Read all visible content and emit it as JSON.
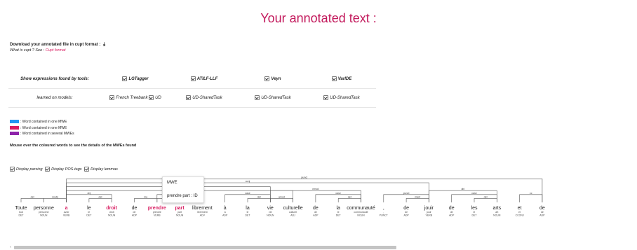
{
  "title": "Your annotated text :",
  "download": {
    "label": "Download your annotated file in cupt format :",
    "icon": "download-icon",
    "icon_glyph": "⤓"
  },
  "cupt_info": {
    "prefix": "What is cupt ? See : ",
    "link": "Cupt format"
  },
  "tools_table": {
    "row1_label": "Show expressions found by tools:",
    "row2_label": "learned on models:",
    "tools": [
      "LGTagger",
      "ATILF-LLF",
      "Veyn",
      "VarIDE"
    ],
    "models": [
      [
        "French Treebank",
        "UD"
      ],
      [
        "UD-SharedTask"
      ],
      [
        "UD-SharedTask"
      ],
      [
        "UD-SharedTask"
      ]
    ]
  },
  "legend": [
    {
      "color": "#2196f3",
      "text": ": Word contained in one MWE"
    },
    {
      "color": "#d81b60",
      "text": ": Word contained in one MWE"
    },
    {
      "color": "#8e24aa",
      "text": ": Word contained in several MWEs"
    }
  ],
  "mouse_hint": "Mouse over the coloured words to see the details of the MWEs found",
  "display_options": [
    "Display parsing",
    "Display POS-tags",
    "Display lemmas"
  ],
  "tooltip": {
    "title": "MWE",
    "text": "prendre part : ID"
  },
  "colors": {
    "mwe": "#d81b60",
    "arc": "#555555"
  },
  "tokens": [
    {
      "word": "Toute",
      "lemma": "tout",
      "pos": "DET",
      "mwe": false
    },
    {
      "word": "personne",
      "lemma": "personne",
      "pos": "NOUN",
      "mwe": false
    },
    {
      "word": "a",
      "lemma": "avoir",
      "pos": "VERB",
      "mwe": true
    },
    {
      "word": "le",
      "lemma": "le",
      "pos": "DET",
      "mwe": false
    },
    {
      "word": "droit",
      "lemma": "droit",
      "pos": "NOUN",
      "mwe": true
    },
    {
      "word": "de",
      "lemma": "de",
      "pos": "ADP",
      "mwe": false
    },
    {
      "word": "prendre",
      "lemma": "prendre",
      "pos": "VERB",
      "mwe": true
    },
    {
      "word": "part",
      "lemma": "part",
      "pos": "NOUN",
      "mwe": true
    },
    {
      "word": "librement",
      "lemma": "librement",
      "pos": "ADV",
      "mwe": false
    },
    {
      "word": "à",
      "lemma": "à",
      "pos": "ADP",
      "mwe": false
    },
    {
      "word": "la",
      "lemma": "le",
      "pos": "DET",
      "mwe": false
    },
    {
      "word": "vie",
      "lemma": "vie",
      "pos": "NOUN",
      "mwe": false
    },
    {
      "word": "culturelle",
      "lemma": "culturel",
      "pos": "ADJ",
      "mwe": false
    },
    {
      "word": "de",
      "lemma": "de",
      "pos": "ADP",
      "mwe": false
    },
    {
      "word": "la",
      "lemma": "le",
      "pos": "DET",
      "mwe": false
    },
    {
      "word": "communauté",
      "lemma": "communauté",
      "pos": "NOUN",
      "mwe": false
    },
    {
      "word": ",",
      "lemma": ",",
      "pos": "PUNCT",
      "mwe": false
    },
    {
      "word": "de",
      "lemma": "de",
      "pos": "ADP",
      "mwe": false
    },
    {
      "word": "jouir",
      "lemma": "jouir",
      "pos": "VERB",
      "mwe": false
    },
    {
      "word": "de",
      "lemma": "de",
      "pos": "ADP",
      "mwe": false
    },
    {
      "word": "les",
      "lemma": "le",
      "pos": "DET",
      "mwe": false
    },
    {
      "word": "arts",
      "lemma": "art",
      "pos": "NOUN",
      "mwe": false
    },
    {
      "word": "et",
      "lemma": "et",
      "pos": "CCONJ",
      "mwe": false
    },
    {
      "word": "de",
      "lemma": "de",
      "pos": "ADP",
      "mwe": false
    }
  ],
  "arcs": [
    {
      "from": 0,
      "to": 1,
      "label": "det",
      "level": 1
    },
    {
      "from": 1,
      "to": 2,
      "label": "nsubj",
      "level": 1
    },
    {
      "from": 3,
      "to": 4,
      "label": "det",
      "level": 1
    },
    {
      "from": 2,
      "to": 4,
      "label": "obj",
      "level": 2
    },
    {
      "from": 5,
      "to": 6,
      "label": "ma",
      "level": 1
    },
    {
      "from": 6,
      "to": 7,
      "label": "obj",
      "level": 1
    },
    {
      "from": 6,
      "to": 8,
      "label": "advmod",
      "level": 2
    },
    {
      "from": 2,
      "to": 11,
      "label": "obl",
      "level": 4
    },
    {
      "from": 10,
      "to": 11,
      "label": "det",
      "level": 1
    },
    {
      "from": 9,
      "to": 11,
      "label": "case",
      "level": 2
    },
    {
      "from": 11,
      "to": 12,
      "label": "amod",
      "level": 1
    },
    {
      "from": 14,
      "to": 15,
      "label": "det",
      "level": 1
    },
    {
      "from": 13,
      "to": 15,
      "label": "case",
      "level": 2
    },
    {
      "from": 11,
      "to": 15,
      "label": "nmod",
      "level": 3
    },
    {
      "from": 17,
      "to": 18,
      "label": "mark",
      "level": 1
    },
    {
      "from": 16,
      "to": 18,
      "label": "punct",
      "level": 2
    },
    {
      "from": 2,
      "to": 18,
      "label": "conj",
      "level": 5
    },
    {
      "from": 20,
      "to": 21,
      "label": "det",
      "level": 1
    },
    {
      "from": 19,
      "to": 21,
      "label": "case",
      "level": 2
    },
    {
      "from": 18,
      "to": 21,
      "label": "obl",
      "level": 3
    },
    {
      "from": 22,
      "to": 23,
      "label": "cc",
      "level": 2
    },
    {
      "from": 2,
      "to": 23,
      "label": "punct",
      "level": 6
    },
    {
      "from": 2,
      "to": 12,
      "label": "obl",
      "level": 3
    }
  ]
}
